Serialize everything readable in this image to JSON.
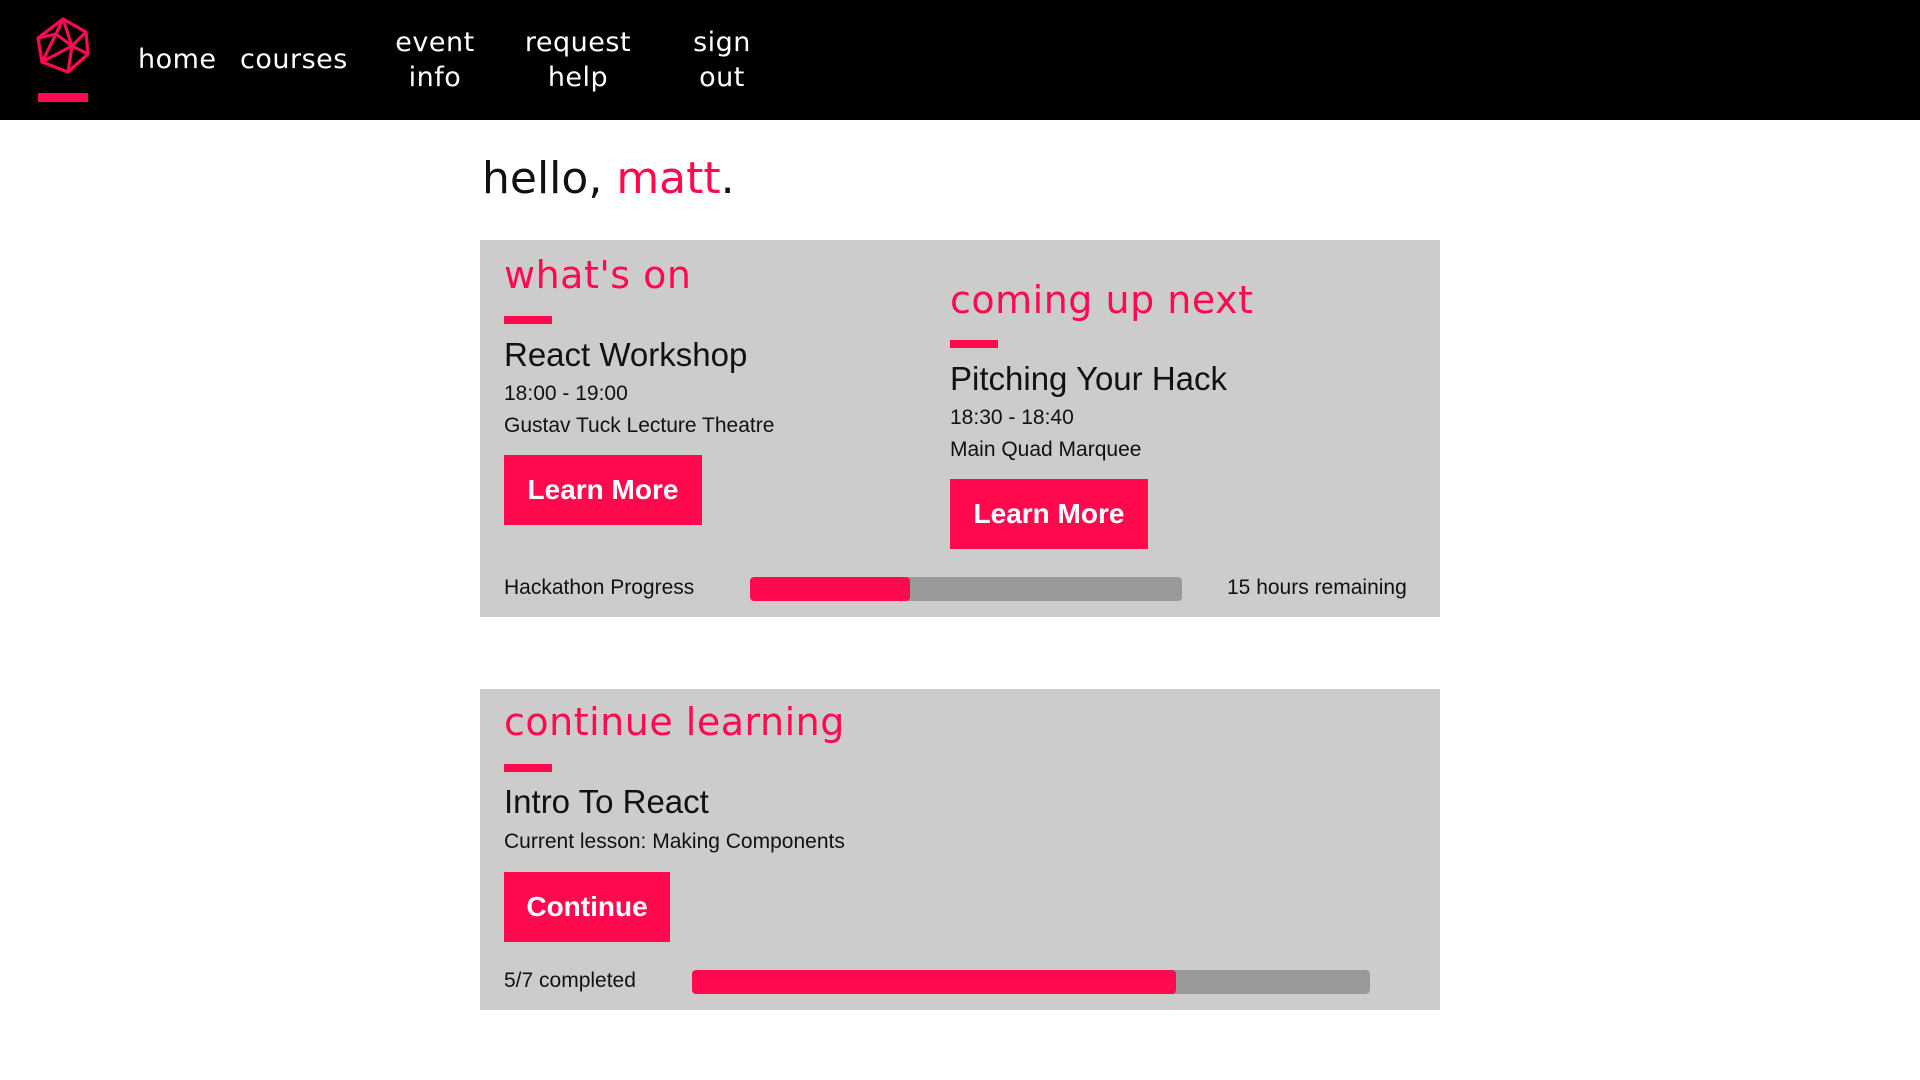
{
  "colors": {
    "accent": "#ff0a4f",
    "nav_background": "#000000",
    "card_background": "#cccccc",
    "track": "#999999"
  },
  "nav": {
    "logo_icon": "polyhedron-gem-icon",
    "items": [
      {
        "label": "home"
      },
      {
        "label": "courses"
      },
      {
        "label_line1": "event",
        "label_line2": "info"
      },
      {
        "label_line1": "request",
        "label_line2": "help"
      },
      {
        "label_line1": "sign",
        "label_line2": "out"
      }
    ]
  },
  "greeting": {
    "prefix": "hello, ",
    "name": "matt",
    "suffix": "."
  },
  "whats_on": {
    "heading": "what's on",
    "event": {
      "title": "React Workshop",
      "time": "18:00 - 19:00",
      "location": "Gustav Tuck Lecture Theatre",
      "button_label": "Learn More"
    }
  },
  "coming_up": {
    "heading": "coming up next",
    "event": {
      "title": "Pitching Your Hack",
      "time": "18:30 - 18:40",
      "location": "Main Quad Marquee",
      "button_label": "Learn More"
    }
  },
  "hackathon_progress": {
    "label": "Hackathon Progress",
    "fraction": 0.37,
    "remaining_text": "15 hours remaining"
  },
  "continue_learning": {
    "heading": "continue learning",
    "course_title": "Intro To React",
    "current_lesson": "Current lesson: Making Components",
    "button_label": "Continue",
    "progress_text": "5/7 completed",
    "completed": 5,
    "total": 7
  }
}
